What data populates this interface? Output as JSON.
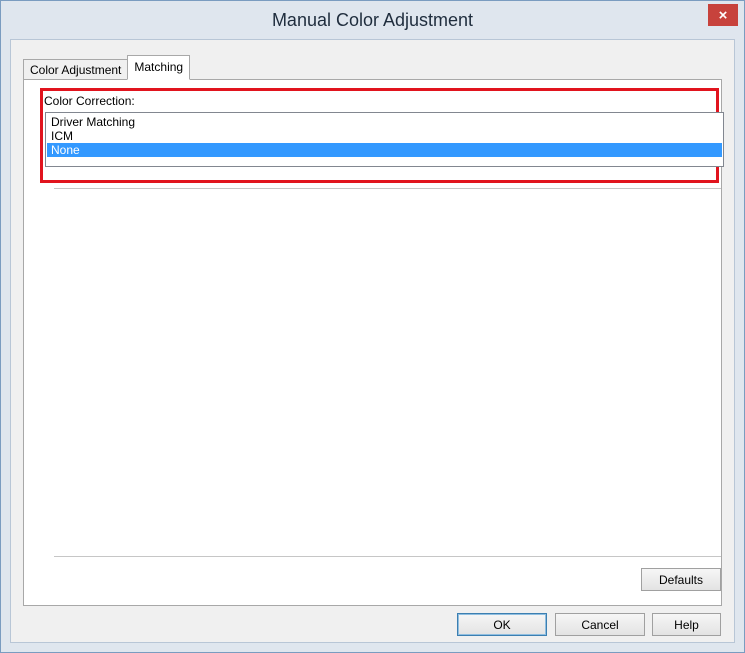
{
  "window": {
    "title": "Manual Color Adjustment",
    "close_glyph": "×"
  },
  "tabs": [
    {
      "label": "Color Adjustment",
      "active": false
    },
    {
      "label": "Matching",
      "active": true
    }
  ],
  "matching": {
    "group_label": "Color Correction:",
    "options": [
      "Driver Matching",
      "ICM",
      "None"
    ],
    "selected": "None"
  },
  "buttons": {
    "defaults": "Defaults",
    "ok": "OK",
    "cancel": "Cancel",
    "help": "Help"
  },
  "colors": {
    "highlight_border": "#e1141e",
    "selection": "#3399ff",
    "close_button": "#c7423c"
  }
}
